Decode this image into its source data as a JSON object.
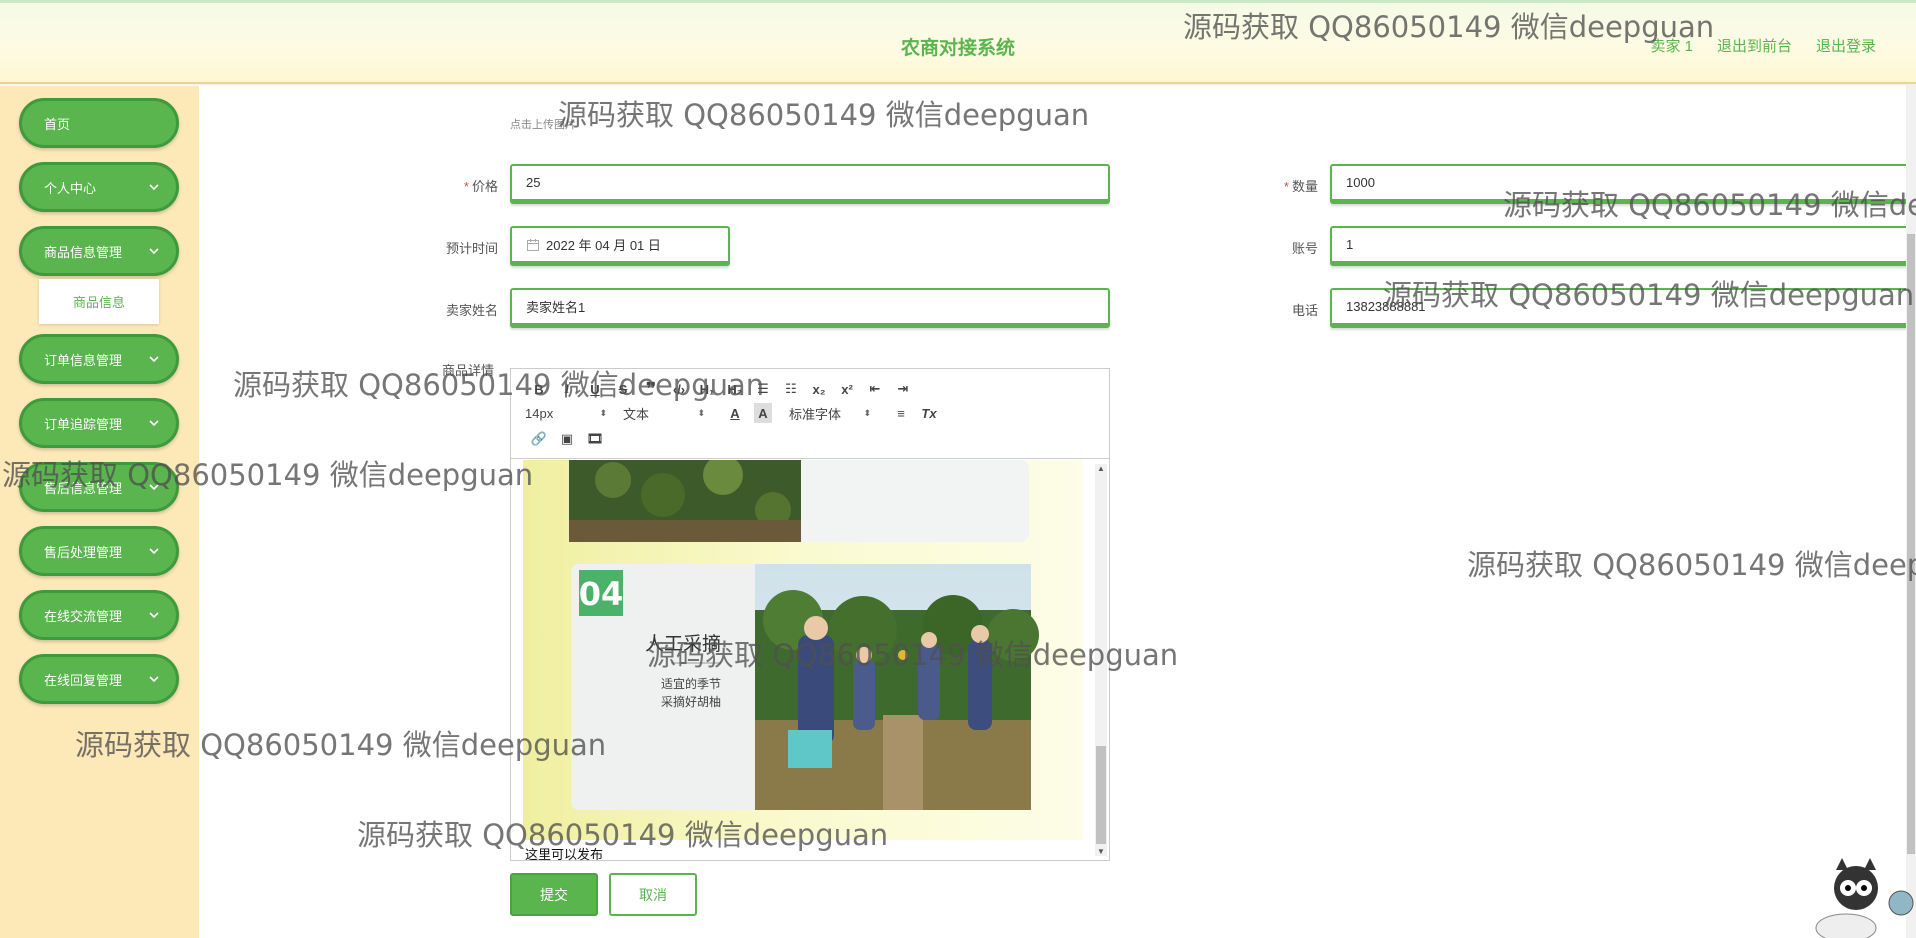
{
  "header": {
    "title": "农商对接系统",
    "user": "卖家 1",
    "to_front": "退出到前台",
    "logout": "退出登录"
  },
  "sidebar": {
    "items": [
      {
        "label": "首页"
      },
      {
        "label": "个人中心"
      },
      {
        "label": "商品信息管理"
      },
      {
        "label": "订单信息管理"
      },
      {
        "label": "订单追踪管理"
      },
      {
        "label": "售后信息管理"
      },
      {
        "label": "售后处理管理"
      },
      {
        "label": "在线交流管理"
      },
      {
        "label": "在线回复管理"
      }
    ],
    "submenu": "商品信息"
  },
  "form": {
    "upload_hint": "点击上传图片",
    "price_label": "价格",
    "price_value": "25",
    "quantity_label": "数量",
    "quantity_value": "1000",
    "expected_time_label": "预计时间",
    "expected_time_value": "2022 年 04 月 01 日",
    "account_label": "账号",
    "account_value": "1",
    "seller_name_label": "卖家姓名",
    "seller_name_value": "卖家姓名1",
    "phone_label": "电话",
    "phone_value": "13823888881",
    "details_label": "商品详情",
    "submit": "提交",
    "cancel": "取消"
  },
  "editor": {
    "font_size": "14px",
    "paragraph": "文本",
    "font_family": "标准字体",
    "footer_text": "这里可以发布",
    "image": {
      "step_number": "04",
      "heading": "人工采摘",
      "subtitle_line1": "适宜的季节",
      "subtitle_line2": "采摘好胡柚"
    }
  },
  "watermark": "源码获取 QQ86050149 微信deepguan",
  "colors": {
    "accent": "#5ab54e",
    "accent_dark": "#3e9a3a",
    "sidebar_bg": "#fde8b8",
    "required": "#e5484d"
  }
}
